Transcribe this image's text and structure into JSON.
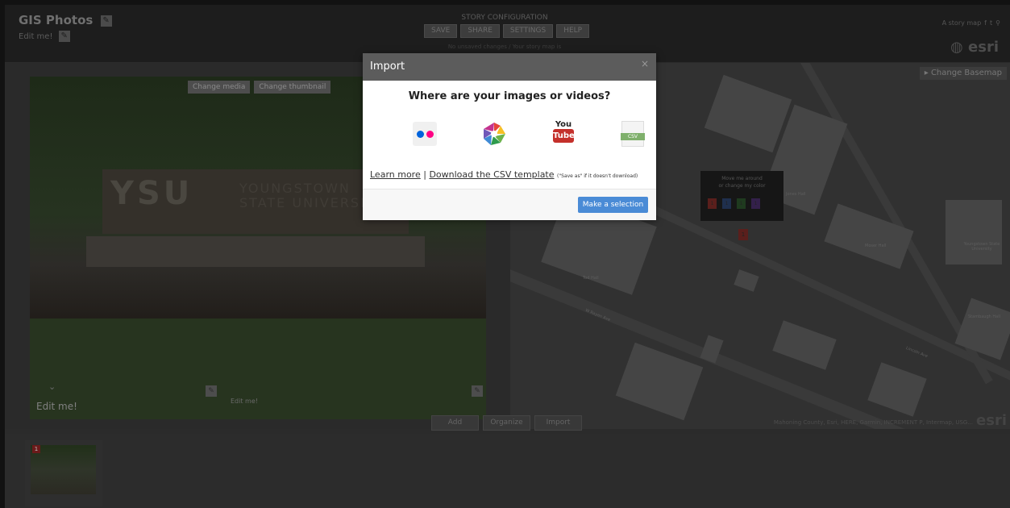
{
  "header": {
    "title": "GIS Photos",
    "subtitle": "Edit me!",
    "story_config_label": "STORY CONFIGURATION",
    "buttons": [
      "SAVE",
      "SHARE",
      "SETTINGS",
      "HELP"
    ],
    "note": "No unsaved changes / Your story map is",
    "story_map_label": "A story map",
    "brand": "esri"
  },
  "photo": {
    "change_media": "Change media",
    "change_thumbnail": "Change thumbnail",
    "caption": "Edit me!",
    "caption_edit": "Edit me!",
    "sign_text": "YSU",
    "sign_sub": "YOUNGSTOWN STATE UNIVERSITY"
  },
  "map": {
    "change_basemap": "Change Basemap",
    "tooltip_line1": "Move me around",
    "tooltip_line2": "or change my color",
    "pin_number": "1",
    "attribution": "Mahoning County, Esri, HERE, Garmin, INCREMENT P, Intermap, USG...",
    "brand": "esri",
    "labels": [
      "Moser Hall",
      "Tod Hall",
      "Jones Hall",
      "W Rayen Ave",
      "Lincoln Ave",
      "Youngstown State University",
      "Stambaugh Hall"
    ]
  },
  "actions": {
    "buttons": [
      "Add",
      "Organize",
      "Import"
    ]
  },
  "thumbnails": [
    {
      "number": "1"
    }
  ],
  "modal": {
    "title": "Import",
    "close": "×",
    "question": "Where are your images or videos?",
    "sources": [
      "flickr-icon",
      "picasa-icon",
      "youtube-icon",
      "csv-icon"
    ],
    "youtube_top": "You",
    "youtube_bottom": "Tube",
    "csv_label": "CSV",
    "learn_more": "Learn more",
    "separator": "|",
    "download_csv": "Download the CSV template",
    "download_note": "(\"Save as\" if it doesn't download)",
    "select_button": "Make a selection"
  },
  "colors": {
    "accent_blue": "#4a8bd6",
    "youtube_red": "#c4302b",
    "flickr_blue": "#0063dc",
    "flickr_pink": "#ff0084",
    "csv_green": "#7fb06c",
    "overlay_dark": "#2b2b2b"
  }
}
